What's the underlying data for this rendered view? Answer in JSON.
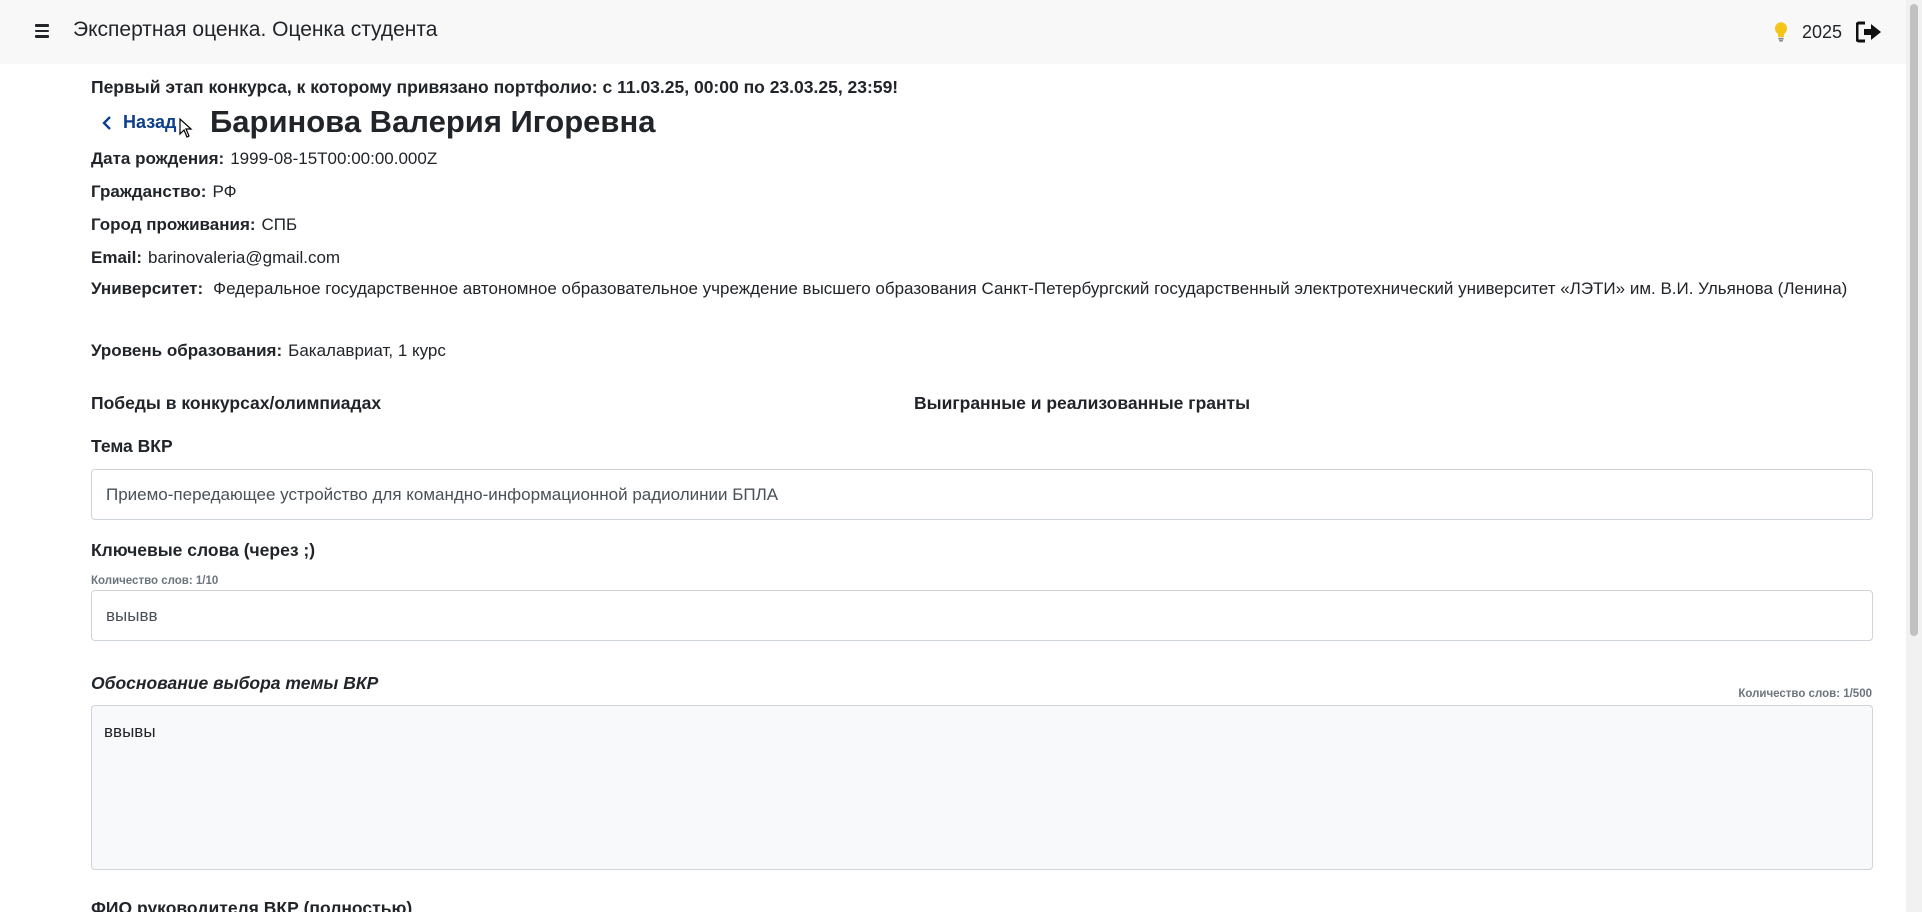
{
  "header": {
    "title": "Экспертная оценка. Оценка студента",
    "year": "2025",
    "icons": {
      "menu": "hamburger-icon",
      "bulb": "lightbulb-icon",
      "logout": "logout-icon"
    }
  },
  "notice": "Первый этап конкурса, к которому привязано портфолио: с 11.03.25, 00:00 по 23.03.25, 23:59!",
  "back_label": "Назад",
  "student": {
    "name": "Баринова Валерия Игоревна",
    "birth_label": "Дата рождения:",
    "birth_value": "1999-08-15T00:00:00.000Z",
    "citizenship_label": "Гражданство:",
    "citizenship_value": "РФ",
    "city_label": "Город проживания:",
    "city_value": "СПБ",
    "email_label": "Email:",
    "email_value": "barinovaleria@gmail.com",
    "university_label": "Университет:",
    "university_value": "Федеральное государственное автономное образовательное учреждение высшего образования Санкт-Петербургский государственный электротехнический университет «ЛЭТИ» им. В.И. Ульянова (Ленина)",
    "level_label": "Уровень образования:",
    "level_value": "Бакалавриат, 1 курс"
  },
  "sections": {
    "wins": "Победы в конкурсах/олимпиадах",
    "grants": "Выигранные и реализованные гранты",
    "topic_label": "Тема ВКР",
    "topic_value": "Приемо-передающее устройство для командно-информационной радиолинии БПЛА",
    "keywords_label": "Ключевые слова (через ;)",
    "keywords_count": "Количество слов: 1/10",
    "keywords_value": "выывв",
    "justification_label": "Обоснование выбора темы ВКР",
    "justification_count": "Количество слов: 1/500",
    "justification_value": "ввывы",
    "supervisor_label": "ФИО руководителя ВКР (полностью)"
  },
  "colors": {
    "accent": "#0d3f8a",
    "bulb": "#f5c518",
    "header_bg": "#f8f8f9"
  }
}
